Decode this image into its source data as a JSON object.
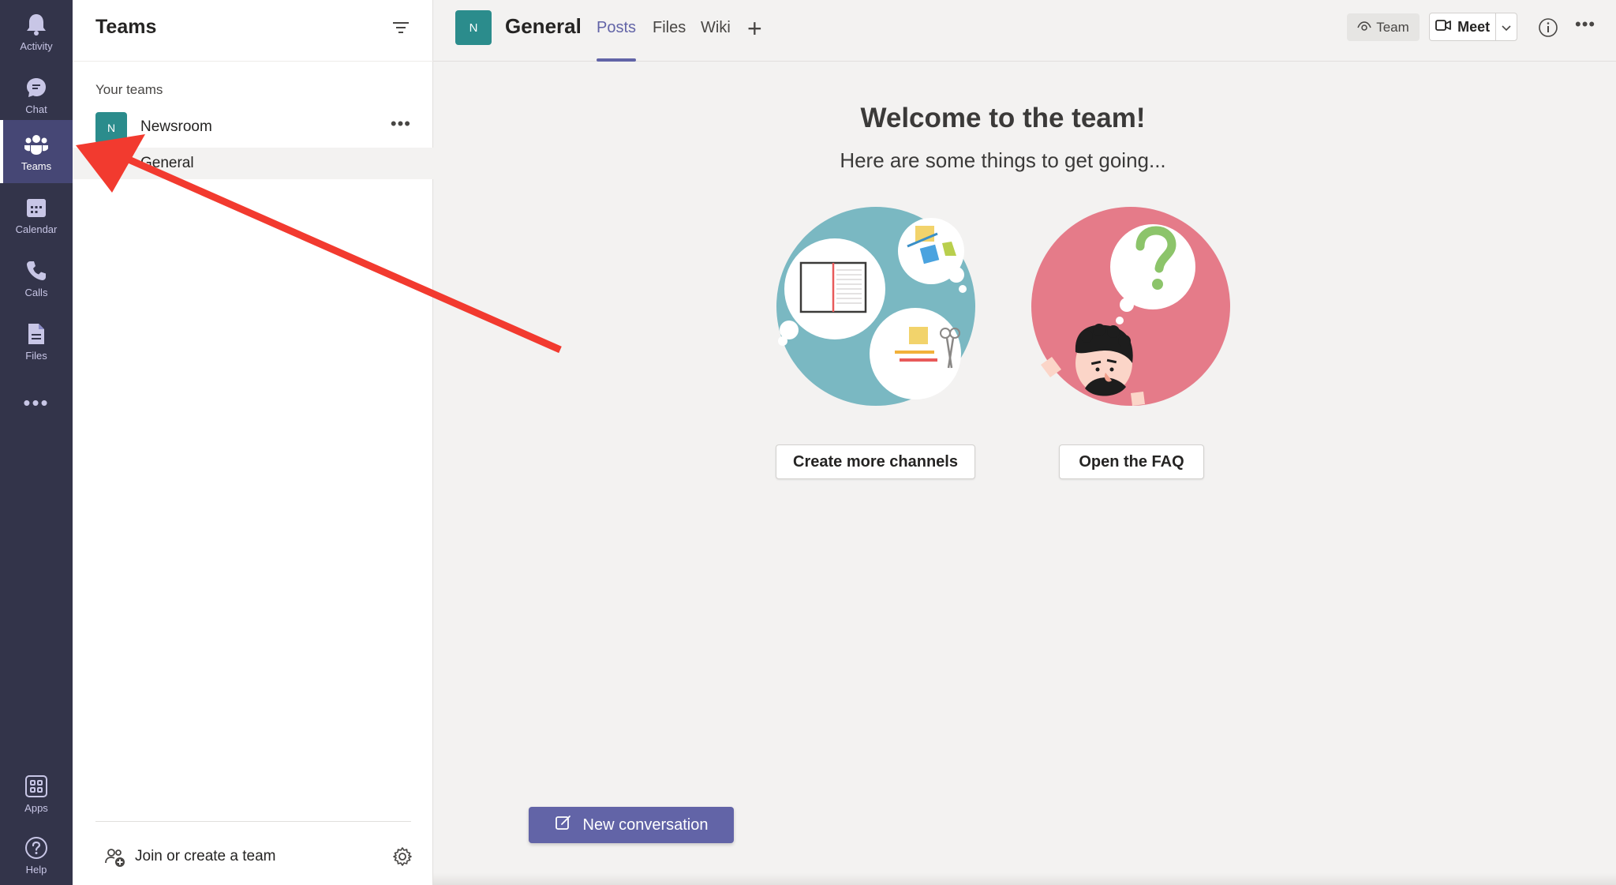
{
  "rail": {
    "items": [
      {
        "label": "Activity",
        "icon": "bell-icon"
      },
      {
        "label": "Chat",
        "icon": "chat-icon"
      },
      {
        "label": "Teams",
        "icon": "teams-icon",
        "active": true
      },
      {
        "label": "Calendar",
        "icon": "calendar-icon"
      },
      {
        "label": "Calls",
        "icon": "phone-icon"
      },
      {
        "label": "Files",
        "icon": "file-icon"
      }
    ],
    "more": "•••",
    "bottom_items": [
      {
        "label": "Apps",
        "icon": "apps-icon"
      },
      {
        "label": "Help",
        "icon": "help-icon"
      }
    ]
  },
  "panel": {
    "title": "Teams",
    "section_label": "Your teams",
    "team": {
      "initial": "N",
      "name": "Newsroom",
      "more": "•••"
    },
    "channel": {
      "name": "General"
    },
    "join_label": "Join or create a team"
  },
  "topbar": {
    "channel_initial": "N",
    "channel_title": "General",
    "tabs": [
      {
        "label": "Posts",
        "active": true
      },
      {
        "label": "Files"
      },
      {
        "label": "Wiki"
      }
    ],
    "add_tab": "+",
    "team_button": "Team",
    "meet_button": "Meet",
    "more": "•••"
  },
  "main": {
    "welcome_title": "Welcome to the team!",
    "welcome_subtitle": "Here are some things to get going...",
    "cards": [
      {
        "button": "Create more channels"
      },
      {
        "button": "Open the FAQ"
      }
    ],
    "new_conversation": "New conversation"
  },
  "colors": {
    "rail_bg": "#33344a",
    "accent": "#6264a7",
    "team_avatar": "#2b8c8c",
    "annotation_arrow": "#f23a2f"
  }
}
